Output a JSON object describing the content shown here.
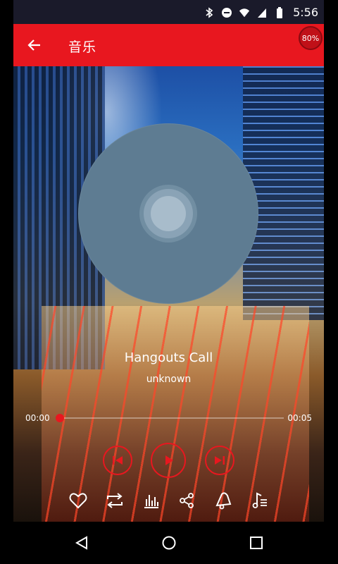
{
  "status_bar": {
    "time": "5:56",
    "icons": [
      "bluetooth-icon",
      "do-not-disturb-icon",
      "wifi-icon",
      "signal-icon",
      "battery-icon"
    ]
  },
  "app_bar": {
    "title": "音乐",
    "badge": "80%"
  },
  "player": {
    "song_title": "Hangouts Call",
    "artist": "unknown",
    "current_time": "00:00",
    "total_time": "00:05",
    "progress": 0.0
  },
  "controls": [
    "previous-icon",
    "play-icon",
    "next-icon"
  ],
  "actions": [
    "heart-icon",
    "repeat-icon",
    "equalizer-icon",
    "share-icon",
    "bell-icon",
    "playlist-icon"
  ],
  "nav": [
    "back-icon",
    "home-icon",
    "recents-icon"
  ],
  "colors": {
    "accent": "#e8171f",
    "disc": "#5e7c92"
  }
}
